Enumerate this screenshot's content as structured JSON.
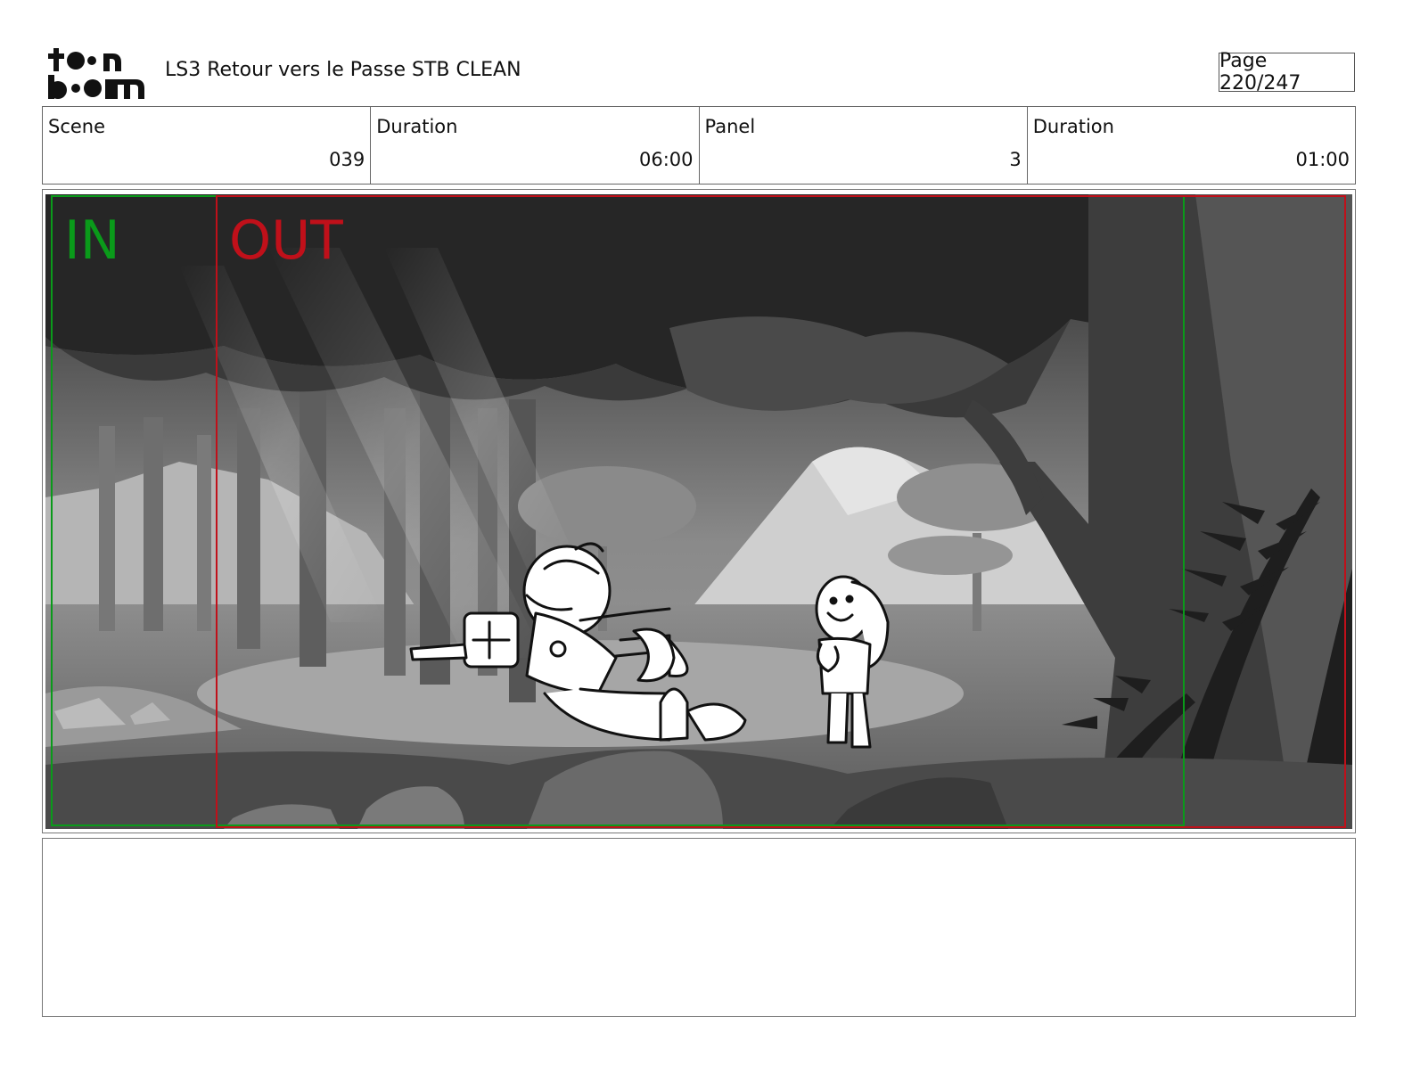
{
  "header": {
    "logo_text": "toonboom",
    "document_title": "LS3 Retour vers le Passe STB CLEAN",
    "page_indicator": "Page 220/247"
  },
  "info_table": [
    {
      "label": "Scene",
      "value": "039"
    },
    {
      "label": "Duration",
      "value": "06:00"
    },
    {
      "label": "Panel",
      "value": "3"
    },
    {
      "label": "Duration",
      "value": "01:00"
    }
  ],
  "panel": {
    "in_marker": "IN",
    "out_marker": "OUT",
    "colors": {
      "in": "#0a9a1a",
      "out": "#c0101a"
    }
  },
  "notes": {
    "text": ""
  }
}
